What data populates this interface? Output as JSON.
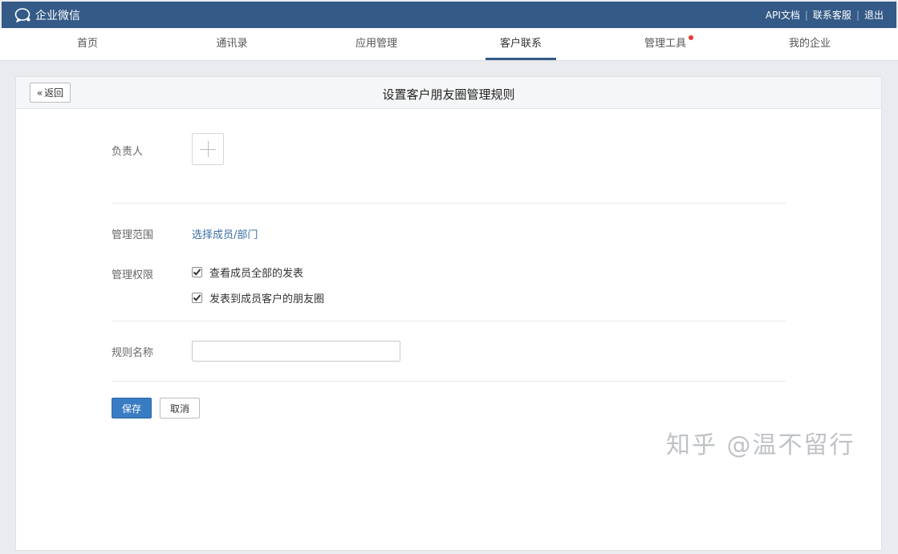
{
  "app": {
    "brand": "企业微信",
    "brand_icon": "chat-bubble-icon",
    "top_links": [
      "API文档",
      "联系客服",
      "退出"
    ]
  },
  "nav": {
    "items": [
      "首页",
      "通讯录",
      "应用管理",
      "客户联系",
      "管理工具",
      "我的企业"
    ],
    "active": "客户联系",
    "badge_item": "管理工具",
    "badge_color": "#e53935"
  },
  "page": {
    "back_label": "返回",
    "title": "设置客户朋友圈管理规则"
  },
  "form": {
    "owner_label": "负责人",
    "scope_label": "管理范围",
    "scope_link": "选择成员/部门",
    "permission_label": "管理权限",
    "permissions": [
      {
        "label": "查看成员全部的发表",
        "checked": true
      },
      {
        "label": "发表到成员客户的朋友圈",
        "checked": true
      }
    ],
    "rule_name_label": "规则名称",
    "rule_name_value": "",
    "save_label": "保存",
    "cancel_label": "取消"
  },
  "watermark": "知乎 @温不留行",
  "colors": {
    "topbar": "#345a87",
    "primary_button": "#3a7cc3",
    "link": "#3a6ea5"
  }
}
